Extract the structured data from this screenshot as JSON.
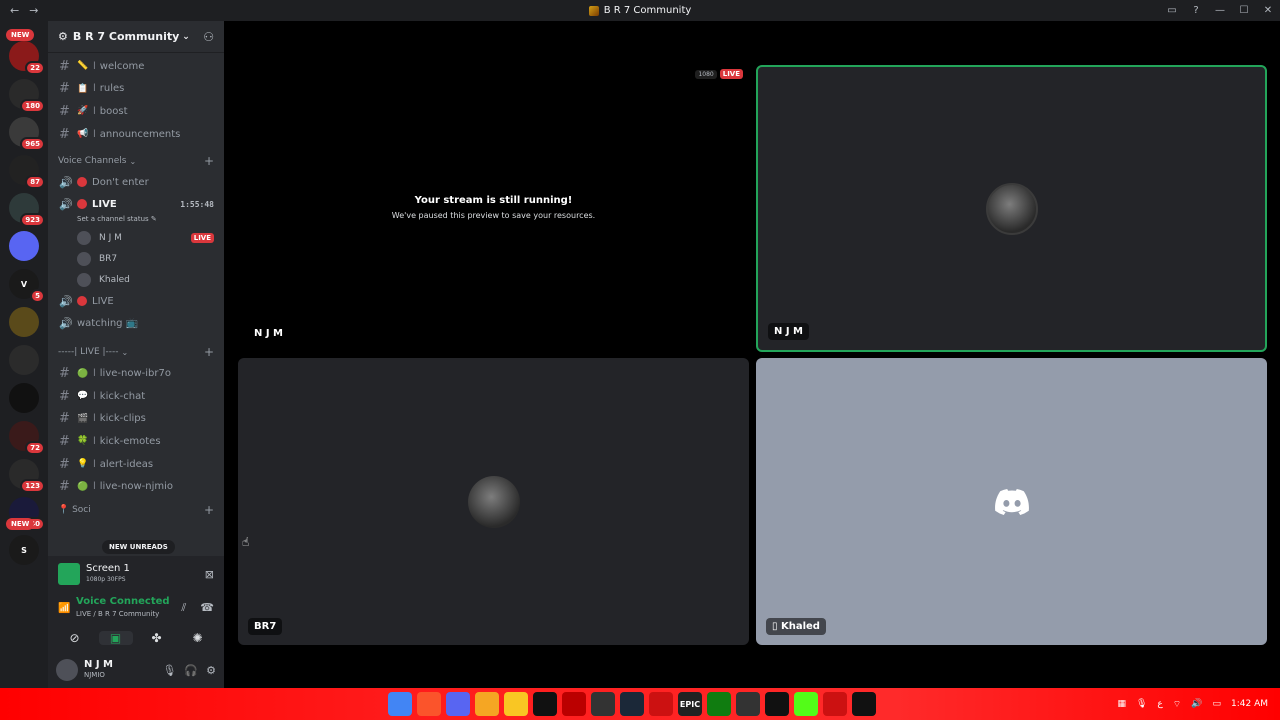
{
  "window": {
    "title": "B R 7 Community",
    "nav_back": "←",
    "nav_forward": "→",
    "controls": [
      "▭",
      "?",
      "—",
      "☐",
      "✕"
    ]
  },
  "guilds": {
    "new_top": "NEW",
    "new_bottom": "NEW",
    "items": [
      {
        "label": "",
        "badge": "22",
        "color": "#8b1a1a"
      },
      {
        "label": "",
        "badge": "180",
        "color": "#2a2a2a"
      },
      {
        "label": "",
        "badge": "965",
        "color": "#3a3a3a"
      },
      {
        "label": "",
        "badge": "87",
        "color": "#222"
      },
      {
        "label": "",
        "badge": "923",
        "color": "#2e3a3a"
      },
      {
        "label": "",
        "badge": "",
        "color": "#5865f2"
      },
      {
        "label": "V",
        "badge": "5",
        "color": "#1a1a1a"
      },
      {
        "label": "",
        "badge": "",
        "color": "#5a4a1a"
      },
      {
        "label": "",
        "badge": "",
        "color": "#2b2b2b"
      },
      {
        "label": "",
        "badge": "",
        "color": "#111"
      },
      {
        "label": "",
        "badge": "72",
        "color": "#3a1a1a"
      },
      {
        "label": "",
        "badge": "123",
        "color": "#2a2a2a"
      },
      {
        "label": "",
        "badge": "40",
        "color": "#1a1a3a"
      },
      {
        "label": "S",
        "badge": "",
        "color": "#1a1a1a"
      }
    ]
  },
  "server": {
    "name": "B R 7 Community"
  },
  "text_channels": [
    {
      "emoji": "📏",
      "name": "welcome"
    },
    {
      "emoji": "📋",
      "name": "rules"
    },
    {
      "emoji": "🚀",
      "name": "boost"
    },
    {
      "emoji": "📢",
      "name": "announcements"
    }
  ],
  "voice_category": "Voice Channels",
  "voice_channels": {
    "dont_enter": "Don't enter",
    "live": "LIVE",
    "timer": "1:55:48",
    "set_status": "Set a channel status ✎",
    "members": [
      {
        "name": "N J M",
        "badge": "LIVE"
      },
      {
        "name": "BR7",
        "badge": ""
      },
      {
        "name": "Khaled",
        "badge": ""
      }
    ],
    "live2": "LIVE",
    "watching": "watching 📺"
  },
  "live_category": "-----| LIVE |----",
  "live_channels": [
    {
      "emoji": "🟢",
      "name": "live-now-ibr7o"
    },
    {
      "emoji": "💬",
      "name": "kick-chat"
    },
    {
      "emoji": "🎬",
      "name": "kick-clips"
    },
    {
      "emoji": "🍀",
      "name": "kick-emotes"
    },
    {
      "emoji": "💡",
      "name": "alert-ideas"
    },
    {
      "emoji": "🟢",
      "name": "live-now-njmio"
    }
  ],
  "social_partial": "📍 Soci",
  "new_unreads": "NEW UNREADS",
  "panel": {
    "screen_title": "Screen 1",
    "screen_sub": "1080p 30FPS",
    "voice_connected": "Voice Connected",
    "voice_sub": "LIVE / B R 7 Community",
    "user_name": "N J M",
    "user_sub": "NJMIO"
  },
  "stage": {
    "stream_title": "Your stream is still running!",
    "stream_sub": "We've paused this preview to save your resources.",
    "quality": "1080",
    "live_badge": "LIVE",
    "tile_names": [
      "N J M",
      "N J M",
      "BR7",
      "Khaled"
    ]
  },
  "taskbar": {
    "time": "1:42 AM",
    "lang": "ع",
    "apps": [
      {
        "label": "",
        "color": "#4285f4"
      },
      {
        "label": "",
        "color": "#fb542b"
      },
      {
        "label": "",
        "color": "#5865f2"
      },
      {
        "label": "",
        "color": "#f5a623"
      },
      {
        "label": "",
        "color": "#f9c623"
      },
      {
        "label": "",
        "color": "#111"
      },
      {
        "label": "",
        "color": "#b00"
      },
      {
        "label": "",
        "color": "#333"
      },
      {
        "label": "",
        "color": "#1b2838"
      },
      {
        "label": "",
        "color": "#c11"
      },
      {
        "label": "EPIC",
        "color": "#222"
      },
      {
        "label": "",
        "color": "#107c10"
      },
      {
        "label": "",
        "color": "#333"
      },
      {
        "label": "",
        "color": "#111"
      },
      {
        "label": "",
        "color": "#53fc18"
      },
      {
        "label": "",
        "color": "#c11"
      },
      {
        "label": "",
        "color": "#111"
      }
    ]
  }
}
